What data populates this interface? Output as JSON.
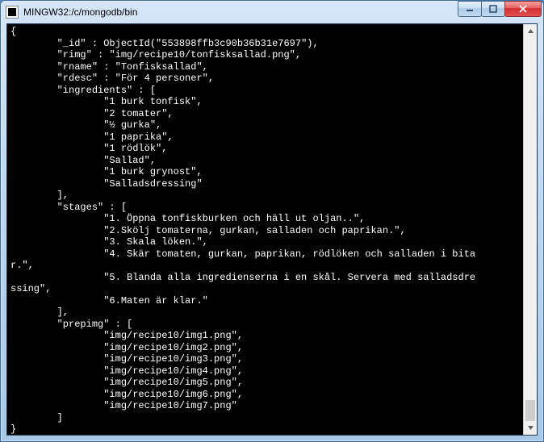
{
  "window": {
    "title": "MINGW32:/c/mongodb/bin"
  },
  "doc": {
    "open": "{",
    "id_key": "\"_id\"",
    "id_val": "ObjectId(\"553898ffb3c90b36b31e7697\")",
    "rimg_key": "\"rimg\"",
    "rimg_val": "\"img/recipe10/tonfisksallad.png\"",
    "rname_key": "\"rname\"",
    "rname_val": "\"Tonfisksallad\"",
    "rdesc_key": "\"rdesc\"",
    "rdesc_val": "\"För 4 personer\"",
    "ingredients_key": "\"ingredients\"",
    "ingredients": [
      "\"1 burk tonfisk\"",
      "\"2 tomater\"",
      "\"½ gurka\"",
      "\"1 paprika\"",
      "\"1 rödlök\"",
      "\"Sallad\"",
      "\"1 burk grynost\"",
      "\"Salladsdressing\""
    ],
    "stages_key": "\"stages\"",
    "stages_line1": "\"1. Öppna tonfiskburken och häll ut oljan..\",",
    "stages_line2": "\"2.Skölj tomaterna, gurkan, salladen och paprikan.\",",
    "stages_line3": "\"3. Skala löken.\",",
    "stages_line4a": "\"4. Skär tomaten, gurkan, paprikan, rödlöken och salladen i bita",
    "stages_line4b": "r.\",",
    "stages_line5a": "\"5. Blanda alla ingredienserna i en skål. Servera med salladsdre",
    "stages_line5b": "ssing\",",
    "stages_line6": "\"6.Maten är klar.\"",
    "prepimg_key": "\"prepimg\"",
    "prepimg": [
      "\"img/recipe10/img1.png\"",
      "\"img/recipe10/img2.png\"",
      "\"img/recipe10/img3.png\"",
      "\"img/recipe10/img4.png\"",
      "\"img/recipe10/img5.png\"",
      "\"img/recipe10/img6.png\"",
      "\"img/recipe10/img7.png\""
    ],
    "close": "}",
    "prompt": ">"
  }
}
